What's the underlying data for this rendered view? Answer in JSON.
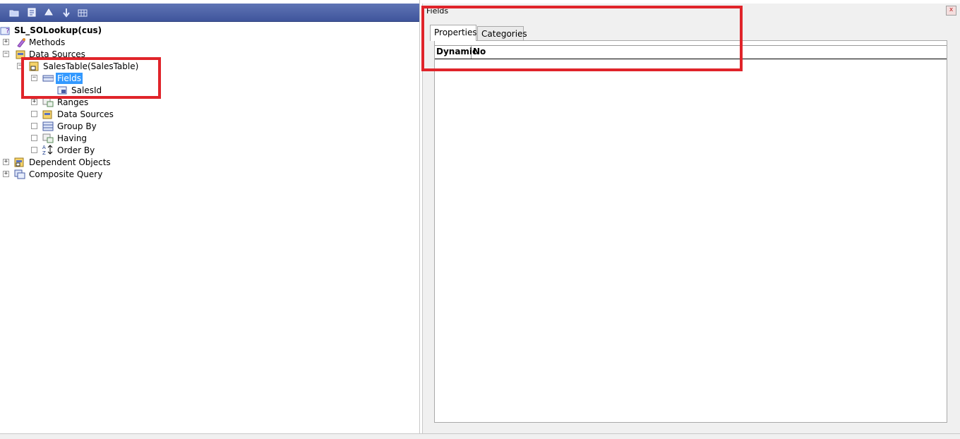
{
  "toolbar": {
    "buttons": [
      {
        "icon": "open-folder-icon"
      },
      {
        "icon": "properties-icon"
      },
      {
        "icon": "compile-icon"
      },
      {
        "icon": "move-down-icon"
      },
      {
        "icon": "grid-icon"
      }
    ]
  },
  "tree": {
    "root": "SL_SOLookup(cus)",
    "items": [
      {
        "label": "Methods",
        "expander": "+"
      },
      {
        "label": "Data Sources",
        "expander": "−"
      },
      {
        "label": "SalesTable(SalesTable)",
        "expander": "−"
      },
      {
        "label": "Fields",
        "expander": "−",
        "selected": true
      },
      {
        "label": "SalesId"
      },
      {
        "label": "Ranges",
        "expander": "+"
      },
      {
        "label": "Data Sources",
        "expander": ""
      },
      {
        "label": "Group By",
        "expander": ""
      },
      {
        "label": "Having",
        "expander": ""
      },
      {
        "label": "Order By",
        "expander": ""
      },
      {
        "label": "Dependent Objects",
        "expander": "+"
      },
      {
        "label": "Composite Query",
        "expander": "+"
      }
    ]
  },
  "properties": {
    "title": "Fields",
    "close": "x",
    "tabs": [
      "Properties",
      "Categories"
    ],
    "rows": [
      {
        "name": "Dynamic",
        "value": "No"
      }
    ]
  },
  "colors": {
    "toolbar": "#4a5fa6",
    "selection": "#3399ff",
    "highlight": "#e0242a"
  }
}
